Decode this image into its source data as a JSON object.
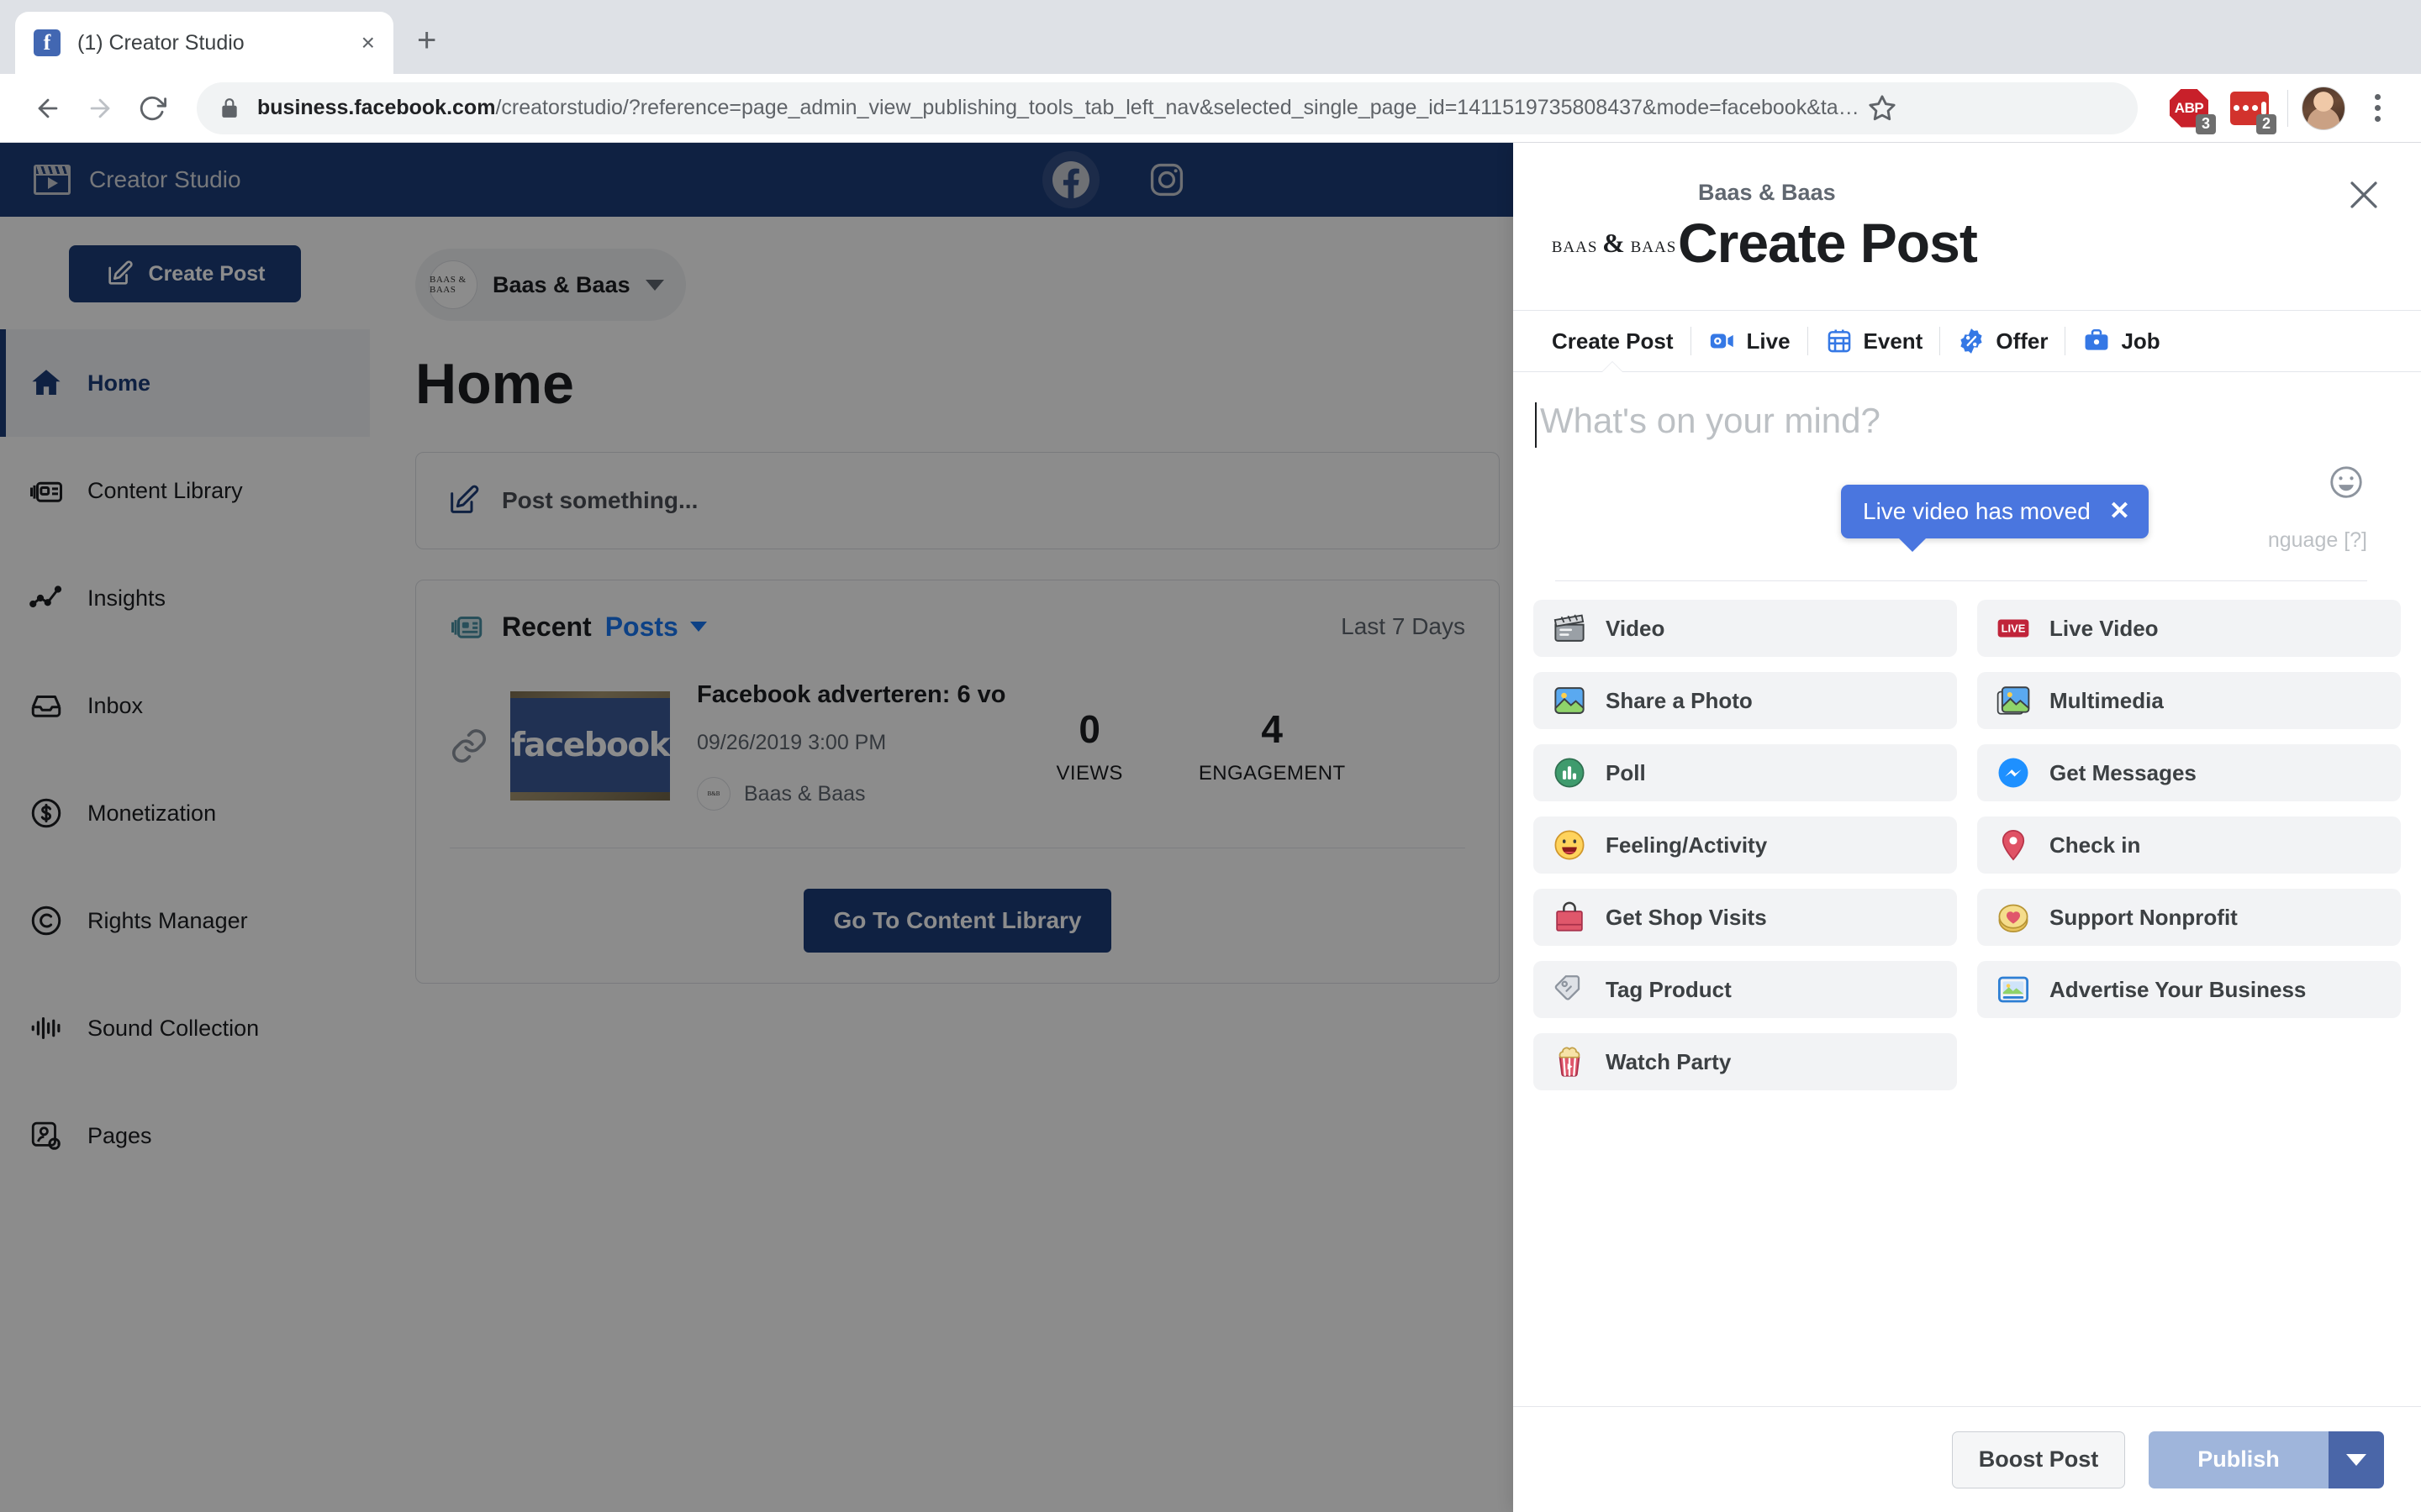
{
  "browser": {
    "tab": {
      "title": "(1) Creator Studio",
      "favicon": "facebook-favicon",
      "close": "×"
    },
    "new_tab_label": "+",
    "url_domain": "business.facebook.com",
    "url_path": "/creatorstudio/?reference=page_admin_view_publishing_tools_tab_left_nav&selected_single_page_id=1411519735808437&mode=facebook&ta…",
    "extensions": [
      {
        "name": "adblock-plus",
        "label": "ABP",
        "badge": "3"
      },
      {
        "name": "red-extension",
        "label": "",
        "badge": "2"
      }
    ]
  },
  "creator_studio": {
    "brand": "Creator Studio",
    "platforms": [
      {
        "name": "facebook",
        "active": true
      },
      {
        "name": "instagram",
        "active": false
      }
    ],
    "sidebar": {
      "create_post_label": "Create Post",
      "items": [
        {
          "label": "Home",
          "icon": "home-icon",
          "active": true
        },
        {
          "label": "Content Library",
          "icon": "content-library-icon",
          "active": false
        },
        {
          "label": "Insights",
          "icon": "insights-icon",
          "active": false
        },
        {
          "label": "Inbox",
          "icon": "inbox-icon",
          "active": false
        },
        {
          "label": "Monetization",
          "icon": "dollar-circle-icon",
          "active": false
        },
        {
          "label": "Rights Manager",
          "icon": "copyright-icon",
          "active": false
        },
        {
          "label": "Sound Collection",
          "icon": "sound-wave-icon",
          "active": false
        },
        {
          "label": "Pages",
          "icon": "pages-gear-icon",
          "active": false
        }
      ]
    },
    "page_selector": {
      "name": "Baas & Baas",
      "avatar_text": "BAAS & BAAS"
    },
    "page_title": "Home",
    "composer_prompt": "Post something...",
    "recent": {
      "title": "Recent",
      "subtitle": "Posts",
      "range": "Last 7 Days",
      "post": {
        "headline": "Facebook adverteren: 6 vo",
        "date": "09/26/2019 3:00 PM",
        "author": "Baas & Baas",
        "thumb_text": "facebook",
        "metrics": [
          {
            "value": "0",
            "label": "VIEWS"
          },
          {
            "value": "4",
            "label": "ENGAGEMENT"
          }
        ]
      },
      "library_button": "Go To Content Library"
    }
  },
  "modal": {
    "page_name": "Baas & Baas",
    "title": "Create Post",
    "logo_text": "BAAS & BAAS",
    "close_label": "×",
    "tabs": [
      {
        "label": "Create Post",
        "icon": null,
        "active": true
      },
      {
        "label": "Live",
        "icon": "live-camera-icon",
        "active": false
      },
      {
        "label": "Event",
        "icon": "calendar-icon",
        "active": false
      },
      {
        "label": "Offer",
        "icon": "percent-badge-icon",
        "active": false
      },
      {
        "label": "Job",
        "icon": "briefcase-icon",
        "active": false
      }
    ],
    "composer": {
      "value": "",
      "placeholder": "What's on your mind?",
      "add_language": "nguage  [?]",
      "emoji_icon": "smiley-icon"
    },
    "tooltip": {
      "text": "Live video has moved",
      "close": "✕",
      "color": "#4a76df"
    },
    "options_left": [
      {
        "label": "Video",
        "icon": "clapperboard-icon"
      },
      {
        "label": "Share a Photo",
        "icon": "photo-icon"
      },
      {
        "label": "Poll",
        "icon": "poll-icon"
      },
      {
        "label": "Feeling/Activity",
        "icon": "smiley-face-icon"
      },
      {
        "label": "Get Shop Visits",
        "icon": "shopping-bag-icon"
      },
      {
        "label": "Tag Product",
        "icon": "price-tag-icon"
      },
      {
        "label": "Watch Party",
        "icon": "popcorn-icon"
      }
    ],
    "options_right": [
      {
        "label": "Live Video",
        "icon": "live-badge-icon"
      },
      {
        "label": "Multimedia",
        "icon": "multimedia-icon"
      },
      {
        "label": "Get Messages",
        "icon": "messenger-icon"
      },
      {
        "label": "Check in",
        "icon": "location-pin-icon"
      },
      {
        "label": "Support Nonprofit",
        "icon": "heart-coin-icon"
      },
      {
        "label": "Advertise Your Business",
        "icon": "advertise-icon"
      }
    ],
    "footer": {
      "boost_label": "Boost Post",
      "publish_label": "Publish"
    }
  },
  "colors": {
    "fb_blue": "#1877f2",
    "cs_navy": "#1d3c78",
    "tooltip_blue": "#4a76df",
    "publish_disabled": "#9fb5db",
    "publish_caret": "#4a66a8"
  }
}
